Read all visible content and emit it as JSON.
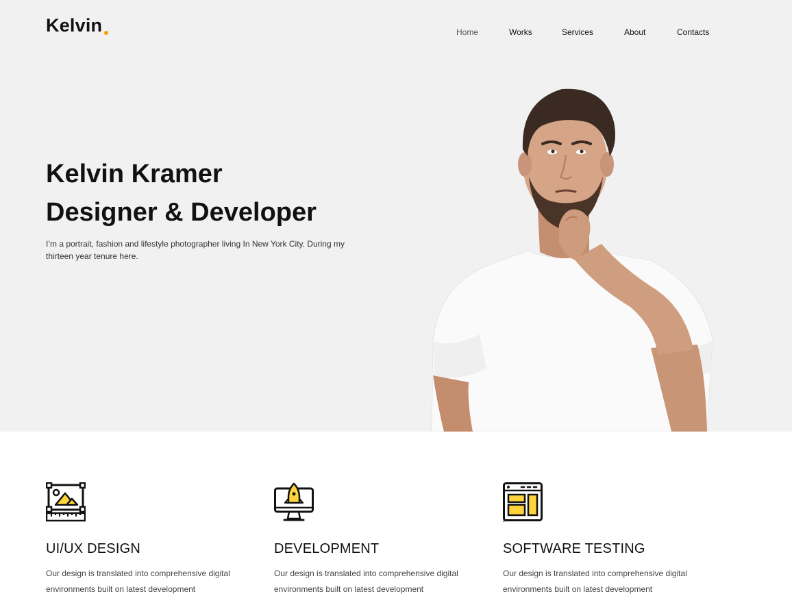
{
  "brand": {
    "name": "Kelvin",
    "dot_color": "#f5a300"
  },
  "nav": {
    "items": [
      {
        "label": "Home",
        "active": true
      },
      {
        "label": "Works"
      },
      {
        "label": "Services"
      },
      {
        "label": "About"
      },
      {
        "label": "Contacts"
      }
    ]
  },
  "hero": {
    "title_line1": "Kelvin Kramer",
    "title_line2": "Designer & Developer",
    "description": "I’m a portrait, fashion and lifestyle photographer living In New York City. During my thirteen year tenure here.",
    "background": "#f1f1f1"
  },
  "services": [
    {
      "title": "UI/UX DESIGN",
      "description": "Our design is translated into comprehensive digital environments built on latest development",
      "icon": "design-icon"
    },
    {
      "title": "DEVELOPMENT",
      "description": "Our design is translated into comprehensive digital environments built on latest development",
      "icon": "rocket-monitor-icon"
    },
    {
      "title": "SOFTWARE TESTING",
      "description": "Our design is translated into comprehensive digital environments built on latest development",
      "icon": "browser-layout-icon"
    }
  ],
  "colors": {
    "accent": "#f5a300",
    "icon_fill": "#ffd43b",
    "text": "#111111"
  }
}
